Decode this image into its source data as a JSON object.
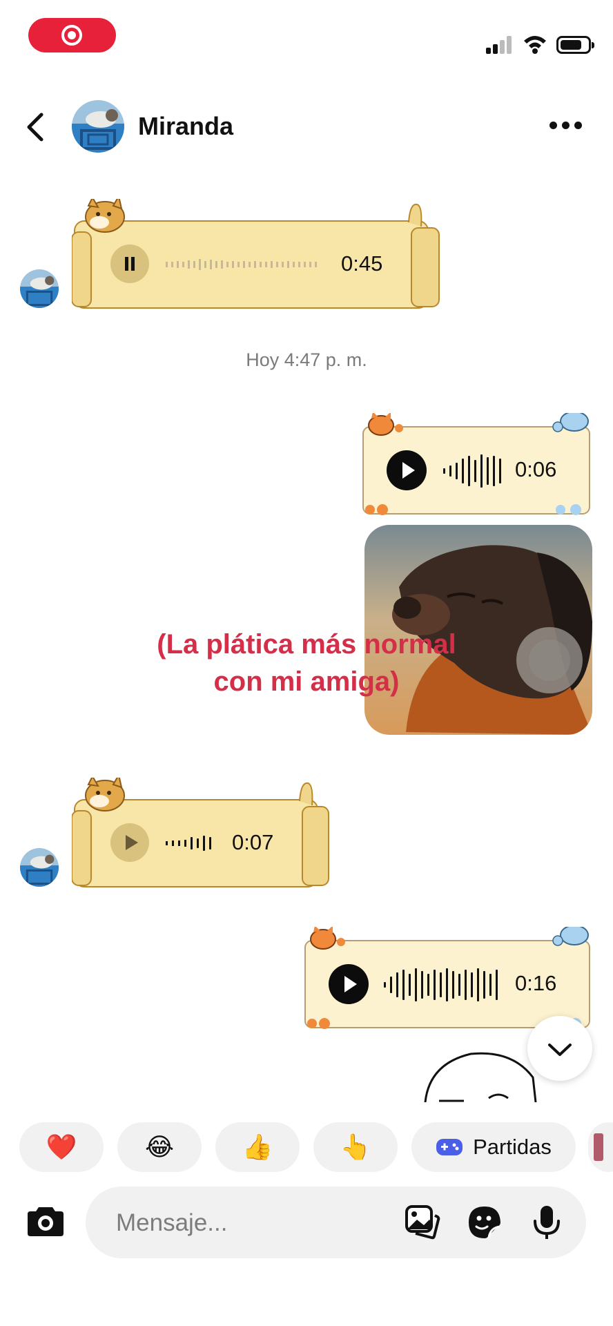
{
  "status_bar": {
    "recording_indicator": "screen-record-icon"
  },
  "header": {
    "contact_name": "Miranda",
    "back_icon": "chevron-left-icon",
    "more_icon": "more-horizontal-icon"
  },
  "messages": [
    {
      "type": "voice",
      "from": "contact",
      "duration": "0:45",
      "state": "playing"
    },
    {
      "type": "timestamp",
      "text": "Hoy 4:47 p. m."
    },
    {
      "type": "voice",
      "from": "me",
      "duration": "0:06"
    },
    {
      "type": "image",
      "from": "me",
      "subject": "dog"
    },
    {
      "type": "voice",
      "from": "contact",
      "duration": "0:07"
    },
    {
      "type": "voice",
      "from": "me",
      "duration": "0:16"
    }
  ],
  "overlay_caption": {
    "line1": "(La plática más normal",
    "line2": "con mi amiga)"
  },
  "quick_reactions": [
    {
      "emoji": "❤️",
      "name": "heart"
    },
    {
      "emoji": "😂",
      "name": "laughing"
    },
    {
      "emoji": "👍",
      "name": "thumbs-up"
    },
    {
      "emoji": "👆",
      "name": "pointing-up"
    },
    {
      "emoji": "🎮",
      "label": "Partidas",
      "name": "games"
    }
  ],
  "composer": {
    "placeholder": "Mensaje..."
  },
  "colors": {
    "accent_red": "#e8213a",
    "caption_red": "#d42e49",
    "bubble_cream": "#f8e6a8"
  }
}
